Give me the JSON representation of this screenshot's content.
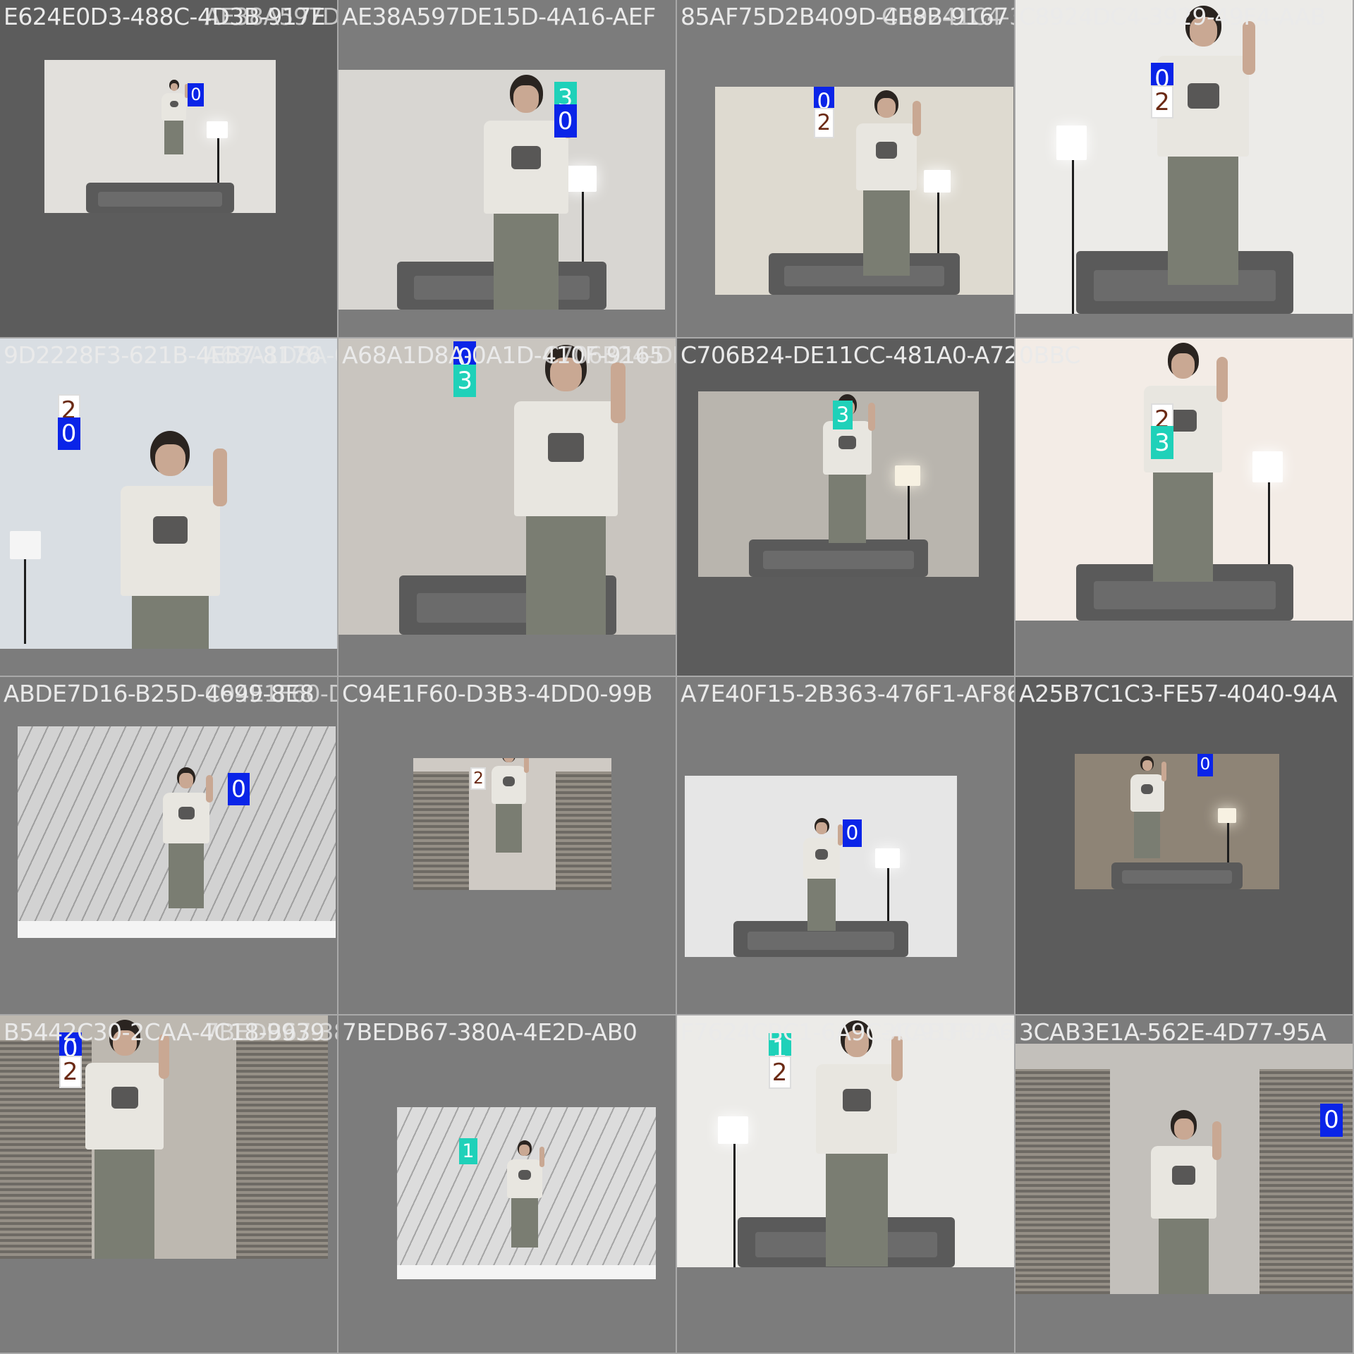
{
  "app": {
    "title": "Detection grid"
  },
  "colors": {
    "canvas": "#7c7c7c",
    "cell_dark": "#5c5c5c",
    "cyan": "#1fd1b9",
    "blue": "#0a24e8",
    "brown": "#6b2a14",
    "white": "#ffffff"
  },
  "cells": [
    {
      "title": "E624E0D3-488C-4D3B-917E",
      "overlay": "AE38A597DE15D-4A16-AEF",
      "scene": "lamp-room",
      "tint": "#e2e0dc",
      "labels": [
        "0"
      ]
    },
    {
      "title": "AE38A597DE15D-4A16-AEF",
      "overlay": "",
      "scene": "lamp-room",
      "tint": "#d8d6d2",
      "labels": [
        "3",
        "0"
      ]
    },
    {
      "title": "85AF75D2B409D-4E8B-9167",
      "overlay": "CB9241C4-3929-49F4-AAB",
      "scene": "lamp-room",
      "tint": "#dedad0",
      "labels": [
        "0",
        "2"
      ]
    },
    {
      "title": "C8924DC4-3929-49F4-AAB",
      "overlay": "",
      "scene": "lamp-room-bright",
      "tint": "#ecebe8",
      "labels": [
        "0",
        "2"
      ]
    },
    {
      "title": "9D2228F3-621B-4EB7-8176",
      "overlay": "A68A1D8A-0A1D-410F-9165",
      "scene": "office",
      "tint": "#d9dee3",
      "labels": [
        "2",
        "0"
      ]
    },
    {
      "title": "A68A1D8A-0A1D-410F-9165",
      "overlay": "C706B24-DE11CC-481A0-A72",
      "scene": "lamp-room-dark",
      "tint": "#c9c5bf",
      "labels": [
        "0",
        "3"
      ]
    },
    {
      "title": "C706B24-DE11CC-481A0-A72",
      "overlay": "",
      "scene": "lamp-room-dark",
      "tint": "#b9b5ae",
      "labels": [
        "3"
      ]
    },
    {
      "title": "0BBC",
      "overlay": "",
      "scene": "lamp-room-warm",
      "tint": "#f3ece6",
      "labels": [
        "2",
        "3"
      ]
    },
    {
      "title": "ABDE7D16-B25D-4699-8E8",
      "overlay": "C94E1F60-D3B3-4DD0-99B",
      "scene": "glass-room",
      "tint": "#d2d2d2",
      "labels": [
        "0"
      ]
    },
    {
      "title": "C94E1F60-D3B3-4DD0-99B",
      "overlay": "",
      "scene": "balcony",
      "tint": "#cfcac4",
      "labels": [
        "2"
      ]
    },
    {
      "title": "A7E40F15-2B363-476F1-AF86",
      "overlay": "",
      "scene": "lamp-room",
      "tint": "#e6e6e6",
      "labels": [
        "0"
      ]
    },
    {
      "title": "A25B7C1C3-FE57-4040-94A",
      "overlay": "",
      "scene": "lamp-room-dark",
      "tint": "#8e8476",
      "labels": [
        "0"
      ]
    },
    {
      "title": "B5442C30-2CAA-4C18-9939",
      "overlay": "7BEDB67-380A-4E2D-AB0",
      "scene": "balcony",
      "tint": "#bdb8b0",
      "labels": [
        "0",
        "2"
      ]
    },
    {
      "title": "7BEDB67-380A-4E2D-AB0",
      "overlay": "",
      "scene": "glass-room",
      "tint": "#dcdcdc",
      "labels": [
        "1"
      ]
    },
    {
      "title": "F7624CBC1-6A9C-4C91F0-A634",
      "overlay": "3CAB3E1A-562E-4D77-95A",
      "scene": "lamp-room-bright",
      "tint": "#ecebe8",
      "labels": [
        "1",
        "2"
      ]
    },
    {
      "title": "3CAB3E1A-562E-4D77-95A",
      "overlay": "",
      "scene": "balcony",
      "tint": "#c3c0bb",
      "labels": [
        "0"
      ]
    }
  ]
}
